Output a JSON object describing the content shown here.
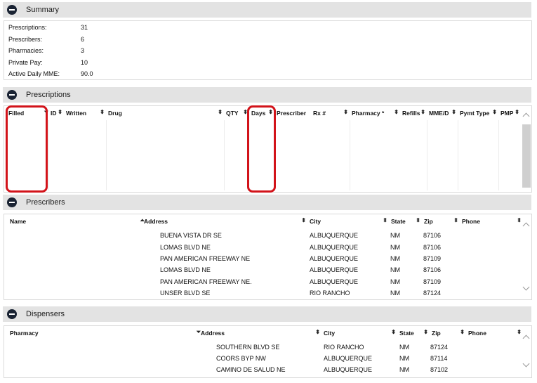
{
  "summary": {
    "title": "Summary",
    "rows": [
      {
        "label": "Prescriptions:",
        "value": "31"
      },
      {
        "label": "Prescribers:",
        "value": "6"
      },
      {
        "label": "Pharmacies:",
        "value": "3"
      },
      {
        "label": "Private Pay:",
        "value": "10"
      },
      {
        "label": "Active Daily MME:",
        "value": "90.0"
      }
    ]
  },
  "prescriptions": {
    "title": "Prescriptions",
    "columns": [
      "Filled",
      "ID",
      "Written",
      "Drug",
      "QTY",
      "Days",
      "Prescriber",
      "Rx #",
      "Pharmacy *",
      "Refills",
      "MME/D",
      "Pymt Type",
      "PMP"
    ]
  },
  "prescribers": {
    "title": "Prescribers",
    "columns": [
      "Name",
      "Address",
      "City",
      "State",
      "Zip",
      "Phone"
    ],
    "rows": [
      {
        "address": "BUENA VISTA DR SE",
        "city": "ALBUQUERQUE",
        "state": "NM",
        "zip": "87106"
      },
      {
        "address": "LOMAS BLVD NE",
        "city": "ALBUQUERQUE",
        "state": "NM",
        "zip": "87106"
      },
      {
        "address": "PAN AMERICAN FREEWAY NE",
        "city": "ALBUQUERQUE",
        "state": "NM",
        "zip": "87109"
      },
      {
        "address": "LOMAS BLVD NE",
        "city": "ALBUQUERQUE",
        "state": "NM",
        "zip": "87106"
      },
      {
        "address": "PAN AMERICAN FREEWAY NE.",
        "city": "ALBUQUERQUE",
        "state": "NM",
        "zip": "87109"
      },
      {
        "address": "UNSER BLVD SE",
        "city": "RIO RANCHO",
        "state": "NM",
        "zip": "87124"
      }
    ]
  },
  "dispensers": {
    "title": "Dispensers",
    "columns": [
      "Pharmacy",
      "Address",
      "City",
      "State",
      "Zip",
      "Phone"
    ],
    "rows": [
      {
        "address": "SOUTHERN BLVD SE",
        "city": "RIO RANCHO",
        "state": "NM",
        "zip": "87124"
      },
      {
        "address": "COORS BYP NW",
        "city": "ALBUQUERQUE",
        "state": "NM",
        "zip": "87114"
      },
      {
        "address": "CAMINO DE SALUD NE",
        "city": "ALBUQUERQUE",
        "state": "NM",
        "zip": "87102"
      }
    ]
  },
  "icons": {
    "section_toggle": "minus-circle-icon",
    "sort": "sort-updown-icon",
    "sort_down": "sort-down-icon",
    "sort_up": "sort-up-icon",
    "scroll_up": "chevron-up-icon",
    "scroll_down": "chevron-down-icon"
  },
  "colors": {
    "section_header_bg": "#e3e3e3",
    "toggle_icon": "#1a2333",
    "highlight": "#d2131a"
  }
}
